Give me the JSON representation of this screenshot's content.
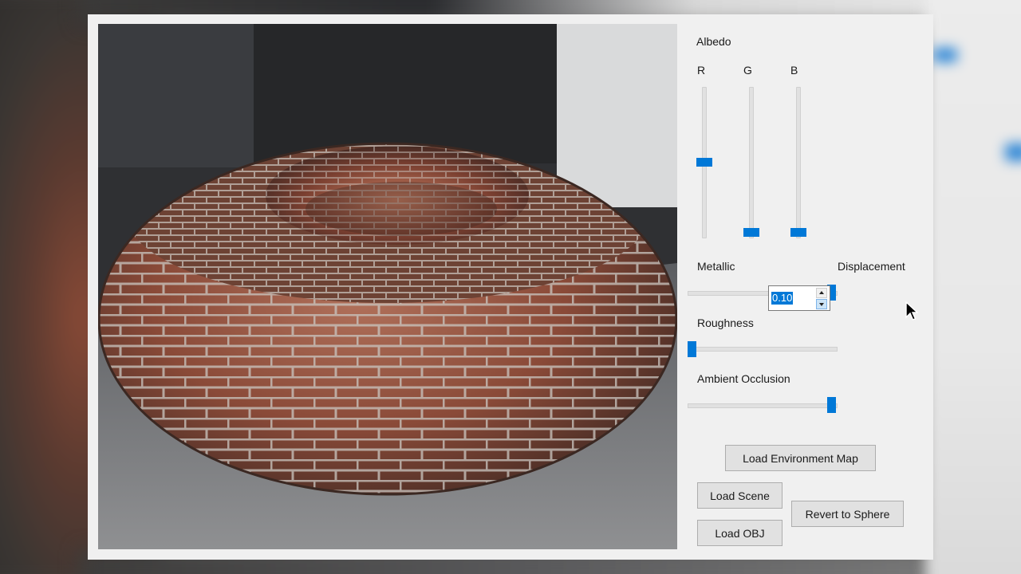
{
  "albedo": {
    "title": "Albedo",
    "channels": [
      {
        "label": "R",
        "value": 0.5
      },
      {
        "label": "G",
        "value": 0.0
      },
      {
        "label": "B",
        "value": 0.0
      }
    ]
  },
  "metallic": {
    "label": "Metallic",
    "value": 1.0
  },
  "roughness": {
    "label": "Roughness",
    "value": 0.0
  },
  "ambient_occlusion": {
    "label": "Ambient Occlusion",
    "value": 1.0
  },
  "displacement": {
    "label": "Displacement",
    "value": "0.10"
  },
  "buttons": {
    "load_env_map": "Load Environment Map",
    "load_scene": "Load Scene",
    "load_obj": "Load OBJ",
    "revert_sphere": "Revert to Sphere"
  },
  "colors": {
    "accent": "#0078d7",
    "window_bg": "#f0f0f0",
    "button_bg": "#e1e1e1"
  }
}
